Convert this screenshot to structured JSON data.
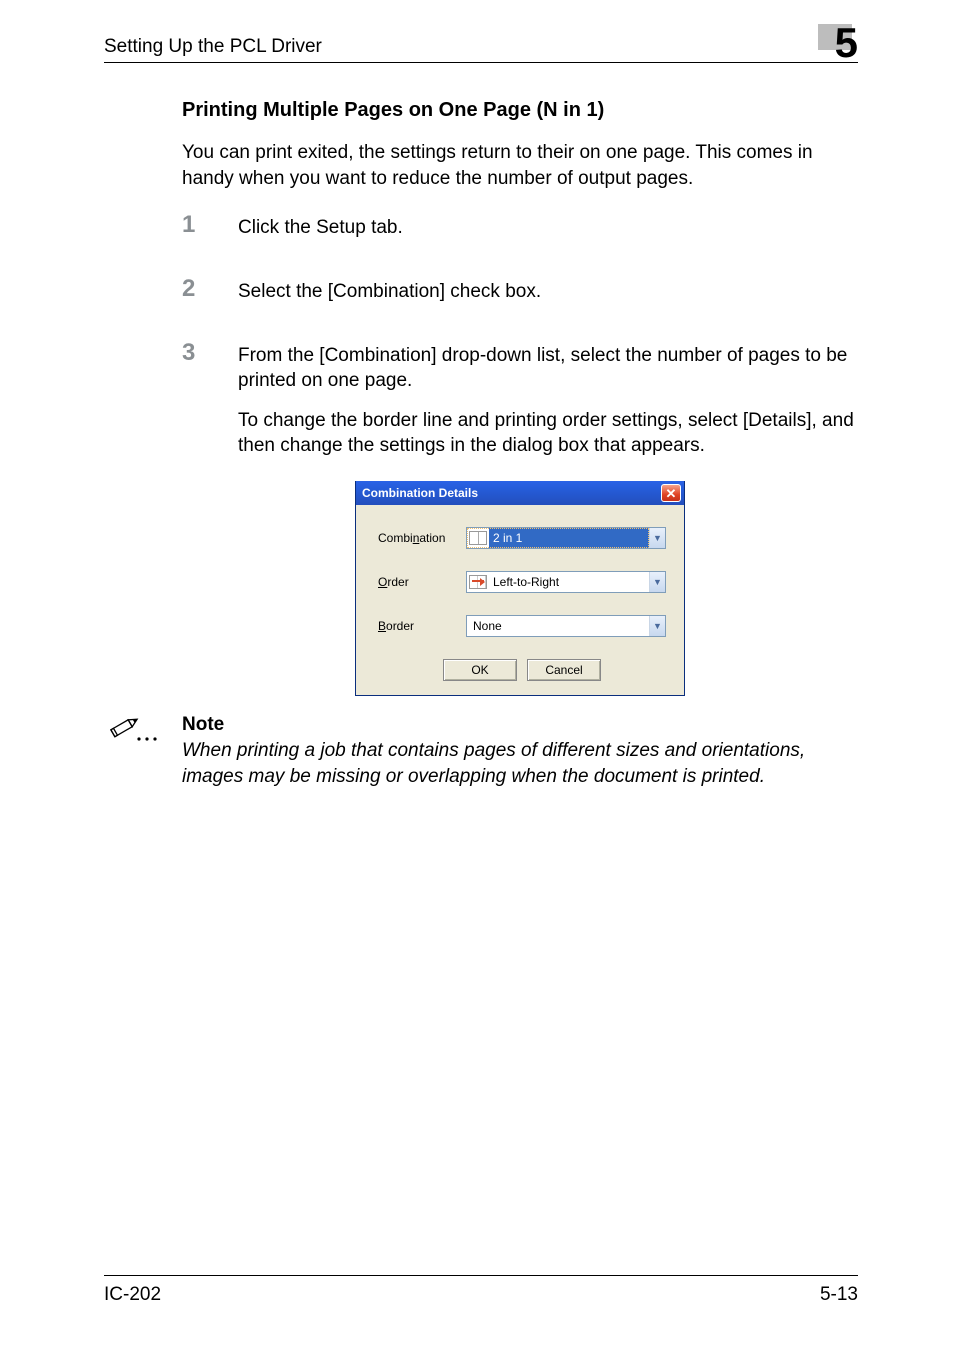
{
  "header": {
    "running_title": "Setting Up the PCL Driver",
    "chapter_number": "5"
  },
  "section": {
    "heading": "Printing Multiple Pages on One Page (N in 1)",
    "intro": "You can print exited, the settings return to their on one page. This comes in handy when you want to reduce the number of output pages."
  },
  "steps": [
    {
      "num": "1",
      "text": "Click the Setup tab."
    },
    {
      "num": "2",
      "text": "Select the [Combination] check box."
    },
    {
      "num": "3",
      "text": "From the [Combination] drop-down list, select the number of pages to be printed on one page.",
      "text2": "To change the border line and printing order settings, select [Details], and then change the settings in the dialog box that appears."
    }
  ],
  "dialog": {
    "title": "Combination Details",
    "close_symbol": "✕",
    "rows": {
      "combination": {
        "label_pre": "Combi",
        "label_u": "n",
        "label_post": "ation",
        "value": "2 in 1"
      },
      "order": {
        "label_u": "O",
        "label_post": "rder",
        "value": "Left-to-Right"
      },
      "border": {
        "label_u": "B",
        "label_post": "order",
        "value": "None"
      }
    },
    "buttons": {
      "ok": "OK",
      "cancel": "Cancel"
    }
  },
  "note": {
    "heading": "Note",
    "text": "When printing a job that contains pages of different sizes and orientations, images may be missing or overlapping when the document is printed."
  },
  "footer": {
    "left": "IC-202",
    "right": "5-13"
  }
}
